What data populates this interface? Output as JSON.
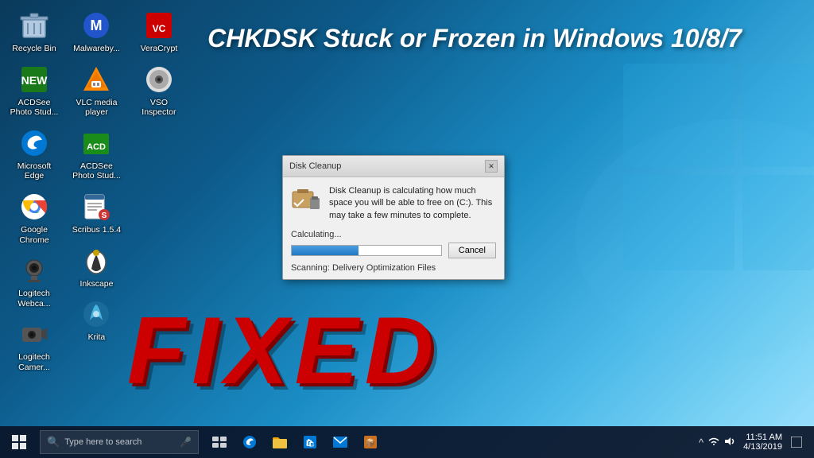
{
  "desktop": {
    "background_colors": [
      "#0a3a5c",
      "#1a8cc4",
      "#7dd4f5"
    ],
    "title": "CHKDSK Stuck or Frozen in Windows 10/8/7",
    "fixed_label": "FIXED"
  },
  "icons": {
    "col1": [
      {
        "id": "recycle-bin",
        "label": "Recycle Bin",
        "emoji": "🗑️"
      },
      {
        "id": "acdsee-photo",
        "label": "ACDSee Photo Stud...",
        "emoji": "📷"
      },
      {
        "id": "microsoft-edge",
        "label": "Microsoft Edge",
        "emoji": "🔵"
      },
      {
        "id": "google-chrome",
        "label": "Google Chrome",
        "emoji": "🔴"
      },
      {
        "id": "logitech-webcam",
        "label": "Logitech Webca...",
        "emoji": "📷"
      },
      {
        "id": "logitech-camera",
        "label": "Logitech Camer...",
        "emoji": "📷"
      }
    ],
    "col2": [
      {
        "id": "malwarebytes",
        "label": "Malwareby...",
        "emoji": "🛡️"
      },
      {
        "id": "vlc",
        "label": "VLC media player",
        "emoji": "🔶"
      },
      {
        "id": "acdsee2",
        "label": "ACDSee Photo Stud...",
        "emoji": "📷"
      },
      {
        "id": "scribus",
        "label": "Scribus 1.5.4",
        "emoji": "📄"
      },
      {
        "id": "inkscape",
        "label": "Inkscape",
        "emoji": "✏️"
      },
      {
        "id": "krita",
        "label": "Krita",
        "emoji": "🎨"
      }
    ],
    "col3": [
      {
        "id": "veracrypt",
        "label": "VeraCrypt",
        "emoji": "🔐"
      },
      {
        "id": "vso",
        "label": "VSO Inspector",
        "emoji": "💿"
      }
    ]
  },
  "dialog": {
    "title": "Disk Cleanup",
    "body_text": "Disk Cleanup is calculating how much space you will be able to free on  (C:). This may take a few minutes to complete.",
    "calculating_label": "Calculating...",
    "cancel_label": "Cancel",
    "scanning_label": "Scanning:  Delivery Optimization Files",
    "progress_percent": 45
  },
  "taskbar": {
    "search_placeholder": "Type here to search",
    "time": "11:51 AM",
    "date": "4/13/2019",
    "start_icon": "⊞",
    "icons": [
      "⊟",
      "🌐",
      "📁",
      "🛍️",
      "✉️",
      "📦"
    ]
  }
}
